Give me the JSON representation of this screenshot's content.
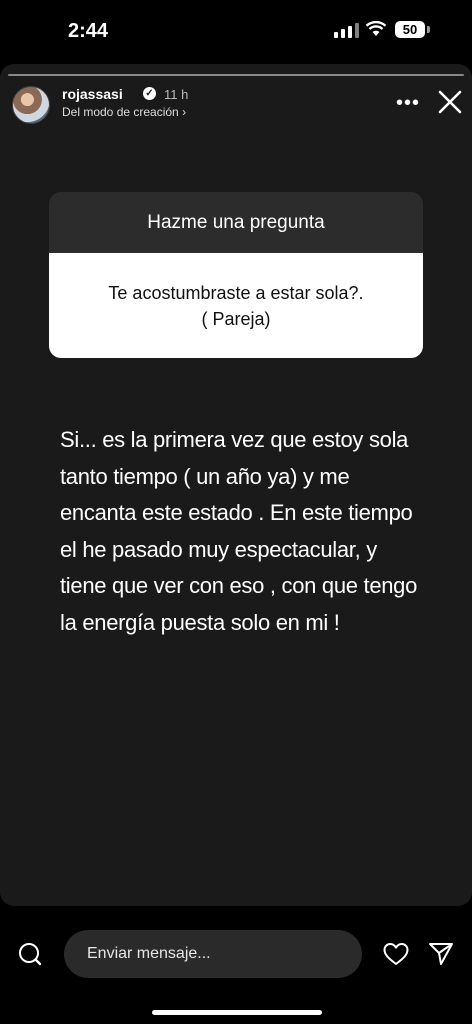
{
  "status": {
    "time": "2:44",
    "battery": "50"
  },
  "story": {
    "username": "rojassasi",
    "time_ago": "11 h",
    "subtitle": "Del modo de creación ›",
    "more": "•••",
    "question_title": "Hazme una pregunta",
    "question_lines": [
      "Te acostumbraste a estar sola?.",
      "( Pareja)"
    ],
    "answer_lines": [
      "Si... es la primera vez que estoy sola",
      "tanto tiempo ( un año ya) y me",
      "encanta este estado . En este tiempo",
      "el he pasado muy espectacular, y",
      "tiene que ver con eso , con que tengo",
      "la energía puesta solo en mi !"
    ]
  },
  "composer": {
    "placeholder": "Enviar mensaje..."
  },
  "icons": {
    "camera": "camera-icon",
    "heart": "heart-icon",
    "send": "send-icon",
    "close": "close-icon",
    "more": "more-icon",
    "verified": "verified-badge-icon"
  }
}
